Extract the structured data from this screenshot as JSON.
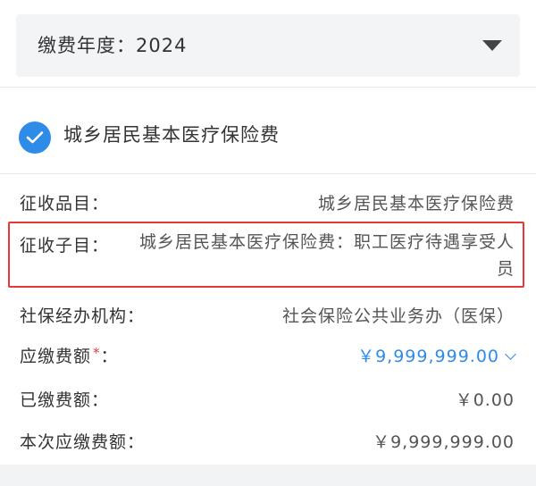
{
  "year_selector": {
    "label": "缴费年度：2024"
  },
  "insurance_item": {
    "label": "城乡居民基本医疗保险费",
    "checked": true
  },
  "details": {
    "category": {
      "label": "征收品目：",
      "value": "城乡居民基本医疗保险费"
    },
    "subcategory": {
      "label": "征收子目：",
      "value": "城乡居民基本医疗保险费：职工医疗待遇享受人员"
    },
    "agency": {
      "label": "社保经办机构：",
      "value": "社会保险公共业务办（医保）"
    },
    "amount_due": {
      "label": "应缴费额",
      "required_mark": "*",
      "colon": "：",
      "value": "￥9,999,999.00"
    },
    "amount_paid": {
      "label": "已缴费额：",
      "value": "￥0.00"
    },
    "current_due": {
      "label": "本次应缴费额：",
      "value": "￥9,999,999.00"
    }
  },
  "colors": {
    "accent": "#2f8be8",
    "highlight": "#e53935",
    "text": "#333333"
  }
}
